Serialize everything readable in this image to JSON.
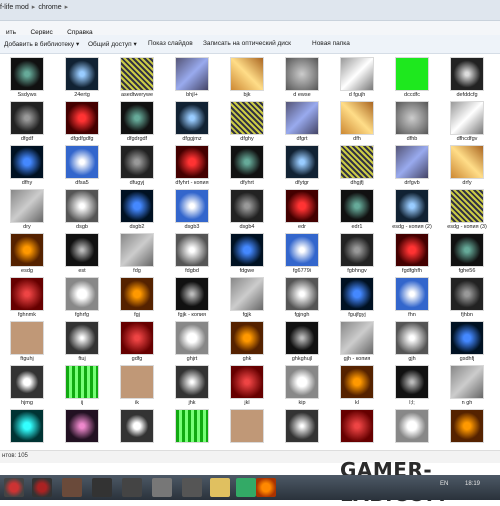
{
  "titlebar": {
    "crumb_left": "f-life mod",
    "crumb_right": "chrome"
  },
  "menubar": {
    "items": [
      "ить",
      "Сервис",
      "Справка"
    ]
  },
  "toolbar": {
    "add_to_library": "Добавить в библиотеку ▾",
    "share": "Общий доступ ▾",
    "slideshow": "Показ слайдов",
    "burn": "Записать на оптический диск",
    "new_folder": "Новая папка"
  },
  "files": [
    [
      "Ssdyws",
      "24ertg",
      "asedtwerywe",
      "bhjl+",
      "bjk",
      "d ewse",
      "d fgujh",
      "dccdfc",
      "defddcfg"
    ],
    [
      "dfgdf",
      "dfgdfgdfg",
      "dfgdrgdf",
      "dfggjmz",
      "dfghy",
      "dfgrt",
      "dfh",
      "dfhb",
      "dfhcdfgv"
    ],
    [
      "dfhy",
      "dfsa5",
      "dfugyj",
      "dfyhrt - копия",
      "dfyhrt",
      "dfytgr",
      "dhgjfj",
      "drfgvb",
      "drfy"
    ],
    [
      "dry",
      "dsgb",
      "dsgb2",
      "dsgb3",
      "dsgb4",
      "edr",
      "edr1",
      "esdg - копия (2)",
      "esdg - копия (3)"
    ],
    [
      "esdg",
      "est",
      "fdg",
      "fdgbd",
      "fdgwe",
      "fg6779i",
      "fgbhngv",
      "fgdfghfh",
      "fghe56"
    ],
    [
      "fghnmk",
      "fghrfg",
      "fgj",
      "fgjk - копия",
      "fgjk",
      "fgjngh",
      "fgujfgyj",
      "fhn",
      "fjhbn"
    ],
    [
      "ftguhj",
      "ftuj",
      "gdfg",
      "ghjrt",
      "ghk",
      "ghkghujl",
      "gjh - копия",
      "gjh",
      "gsdhfj"
    ],
    [
      "hjmg",
      "ij",
      "ik",
      "jhk",
      "jkl",
      "kip",
      "kl",
      "l;l;",
      "n gh"
    ],
    [
      "",
      "",
      "",
      "",
      "",
      "",
      "",
      "",
      ""
    ]
  ],
  "status": {
    "count": "нтов: 105"
  },
  "taskbar": {
    "lang": "EN",
    "time": "18:19"
  },
  "watermark": "GAMER-LAB.COM"
}
